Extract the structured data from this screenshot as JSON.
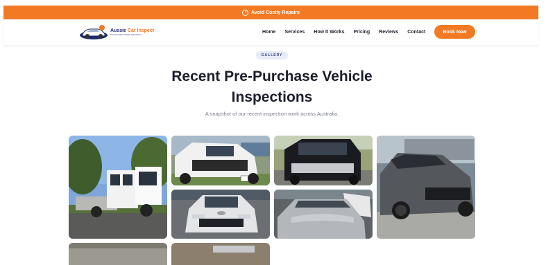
{
  "banner": {
    "text": "Avoid Costly Repairs",
    "icon": "alert-circle-icon"
  },
  "brand": {
    "name_part1": "Aussie",
    "name_part2": "Car Inspect",
    "tagline": "Pre-Purchase Vehicle Inspections",
    "icon": "car-logo-icon"
  },
  "nav": {
    "items": [
      "Home",
      "Services",
      "How It Works",
      "Pricing",
      "Reviews",
      "Contact"
    ],
    "cta": "Book Now"
  },
  "hero": {
    "badge": "GALLERY",
    "title_line1": "Recent Pre-Purchase Vehicle",
    "title_line2": "Inspections",
    "subtitle": "A snapshot of our recent inspection work across Australia."
  },
  "colors": {
    "accent": "#f37a24",
    "navy": "#1d2d6b",
    "heading": "#1b1e2b"
  },
  "gallery": {
    "photos": [
      "white-isuzu-tray-truck-photo",
      "white-toyota-hilux-4x4-photo",
      "black-toyota-alphard-van-photo",
      "silver-toyota-camry-photo",
      "silver-coupe-car-photo",
      "grey-ford-mustang-photo",
      "partial-car-photo-row3-a",
      "partial-car-photo-row3-b"
    ]
  }
}
